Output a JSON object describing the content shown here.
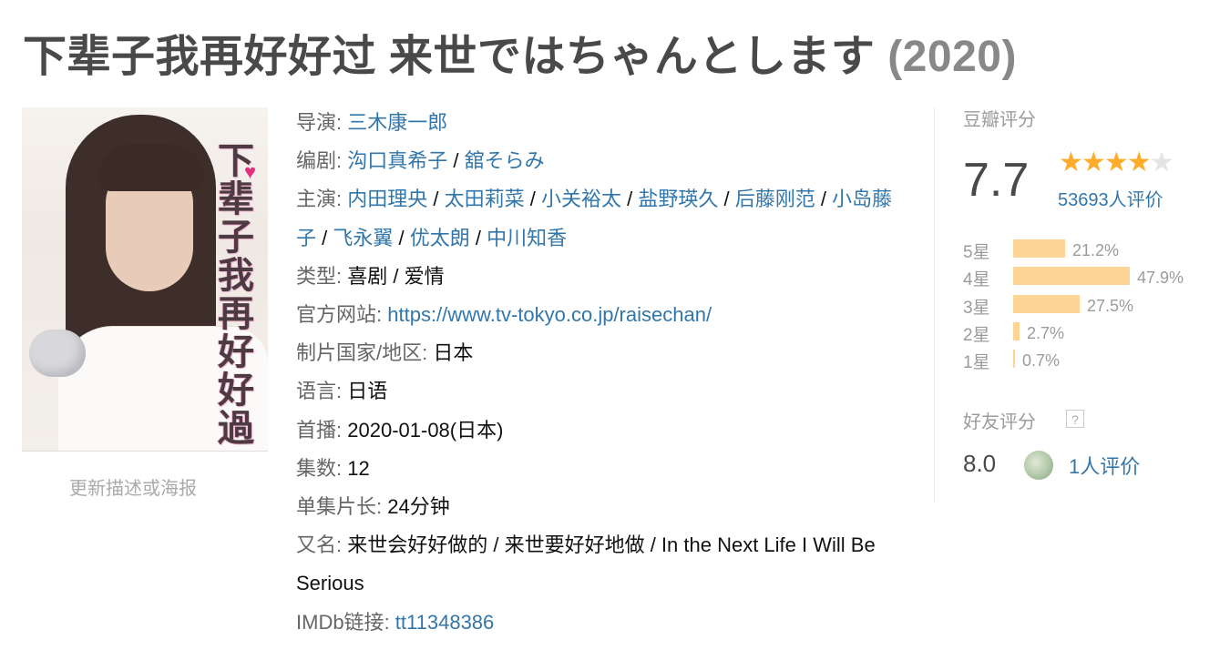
{
  "header": {
    "title": "下辈子我再好好过 来世ではちゃんとします",
    "year": "(2020)"
  },
  "poster": {
    "title_text": "下辈子我再好好過",
    "update_link": "更新描述或海报"
  },
  "info": {
    "director": {
      "label": "导演",
      "names": [
        "三木康一郎"
      ]
    },
    "writers": {
      "label": "编剧",
      "names": [
        "沟口真希子",
        "舘そらみ"
      ]
    },
    "cast": {
      "label": "主演",
      "names": [
        "内田理央",
        "太田莉菜",
        "小关裕太",
        "盐野瑛久",
        "后藤刚范",
        "小岛藤子",
        "飞永翼",
        "优太朗",
        "中川知香"
      ]
    },
    "genre": {
      "label": "类型",
      "value": "喜剧 / 爱情"
    },
    "site": {
      "label": "官方网站",
      "value": "https://www.tv-tokyo.co.jp/raisechan/"
    },
    "country": {
      "label": "制片国家/地区",
      "value": "日本"
    },
    "language": {
      "label": "语言",
      "value": "日语"
    },
    "premiere": {
      "label": "首播",
      "value": "2020-01-08(日本)"
    },
    "episodes": {
      "label": "集数",
      "value": "12"
    },
    "runtime": {
      "label": "单集片长",
      "value": "24分钟"
    },
    "aka": {
      "label": "又名",
      "value": "来世会好好做的 / 来世要好好地做 / In the Next Life I Will Be Serious"
    },
    "imdb": {
      "label": "IMDb链接",
      "value": "tt11348386"
    }
  },
  "rating": {
    "label": "豆瓣评分",
    "score": "7.7",
    "stars": 4,
    "votes": "53693人评价",
    "distribution": [
      {
        "star": "5星",
        "pct": "21.2%",
        "value": 21.2
      },
      {
        "star": "4星",
        "pct": "47.9%",
        "value": 47.9
      },
      {
        "star": "3星",
        "pct": "27.5%",
        "value": 27.5
      },
      {
        "star": "2星",
        "pct": "2.7%",
        "value": 2.7
      },
      {
        "star": "1星",
        "pct": "0.7%",
        "value": 0.7
      }
    ]
  },
  "friends": {
    "label": "好友评分",
    "help": "?",
    "score": "8.0",
    "count": "1人评价"
  }
}
